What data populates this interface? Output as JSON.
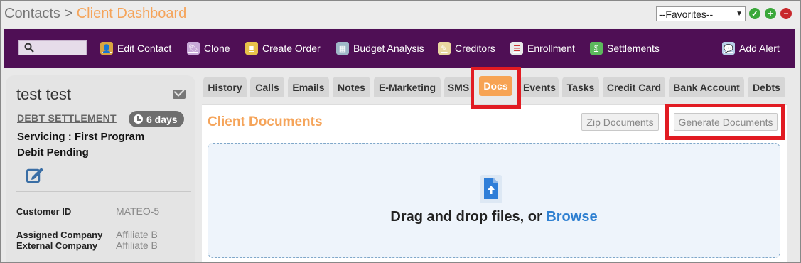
{
  "breadcrumb": {
    "parent": "Contacts",
    "separator": " > ",
    "current": "Client Dashboard"
  },
  "favorites": {
    "selected": "--Favorites--"
  },
  "window_icons": [
    "check-icon",
    "plus-icon",
    "minus-icon"
  ],
  "toolbar": {
    "search_placeholder": "",
    "items": [
      {
        "label": "Edit Contact",
        "icon": "person-edit-icon"
      },
      {
        "label": "Clone",
        "icon": "tag-icon"
      },
      {
        "label": "Create Order",
        "icon": "box-icon"
      },
      {
        "label": "Budget Analysis",
        "icon": "calculator-icon"
      },
      {
        "label": "Creditors",
        "icon": "document-edit-icon"
      },
      {
        "label": "Enrollment",
        "icon": "form-icon"
      },
      {
        "label": "Settlements",
        "icon": "money-icon"
      },
      {
        "label": "Add Alert",
        "icon": "chat-icon"
      }
    ]
  },
  "contact": {
    "name": "test test",
    "program_type": "DEBT SETTLEMENT",
    "days_badge": "6 days",
    "status_line1": "Servicing : First Program",
    "status_line2": "Debit Pending",
    "fields": [
      {
        "label": "Customer ID",
        "value": "MATEO-5"
      },
      {
        "label": "Assigned Company",
        "value": "Affiliate B"
      },
      {
        "label": "External Company",
        "value": "Affiliate B"
      }
    ]
  },
  "tabs": [
    "History",
    "Calls",
    "Emails",
    "Notes",
    "E-Marketing",
    "SMS",
    "Docs",
    "Events",
    "Tasks",
    "Credit Card",
    "Bank Account",
    "Debts"
  ],
  "active_tab": "Docs",
  "documents": {
    "title": "Client Documents",
    "zip_button": "Zip Documents",
    "generate_button": "Generate Documents",
    "drop_text": "Drag and drop files, or ",
    "browse_link": "Browse"
  },
  "colors": {
    "toolbar_bg": "#4f0f55",
    "accent_orange": "#f5a45a",
    "highlight_red": "#e11b22",
    "browse_blue": "#2f80d1"
  }
}
